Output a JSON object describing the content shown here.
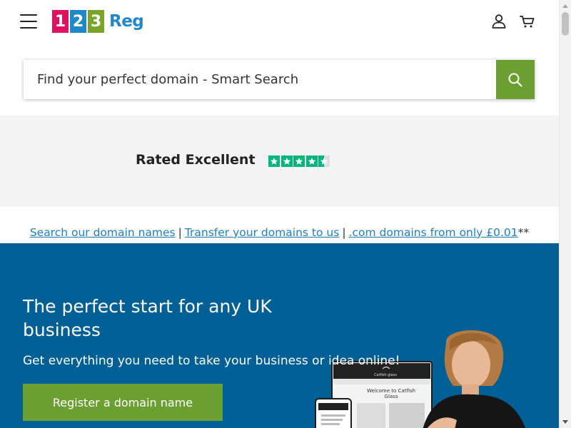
{
  "colors": {
    "tile1": "#e0115f",
    "tile2": "#1f88c8",
    "tile3": "#7aa52a",
    "reg": "#1f88c8",
    "search_button": "#6c9f31",
    "hero_bg": "#005f95",
    "cta": "#6c9f31",
    "trustpilot_green": "#00b67a",
    "link": "#1f7fbd"
  },
  "header": {
    "menu_icon": "hamburger-icon",
    "logo": {
      "digits": [
        "1",
        "2",
        "3"
      ],
      "word": "Reg"
    },
    "account_icon": "user-icon",
    "cart_icon": "cart-icon"
  },
  "search": {
    "placeholder": "Find your perfect domain - Smart Search",
    "button_icon": "search-icon"
  },
  "rating": {
    "label": "Rated Excellent",
    "stars": 4.5,
    "max_stars": 5
  },
  "links": {
    "items": [
      "Search our domain names",
      "Transfer your domains to us",
      ".com domains from only £0.01"
    ],
    "separator": "|",
    "suffix": "**"
  },
  "hero": {
    "title": "The perfect start for any UK business",
    "subtitle": "Get everything you need to take your business or idea online!",
    "cta_label": "Register a domain name",
    "mockup": {
      "site_name": "Catfish glass",
      "welcome": "Welcome to Catfish",
      "welcome2": "Glass"
    }
  }
}
